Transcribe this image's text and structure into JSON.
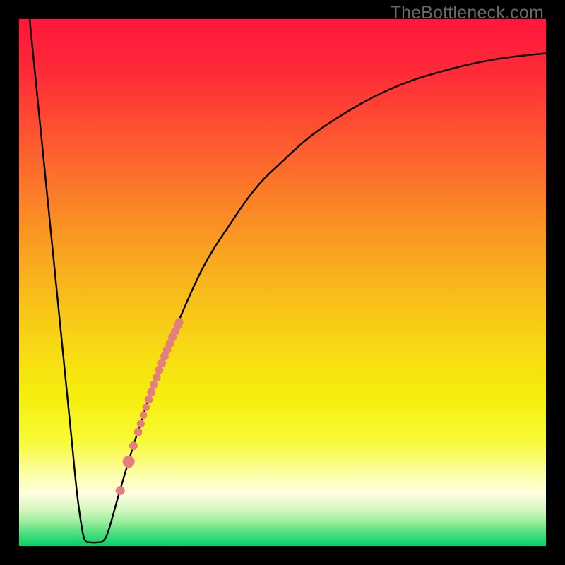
{
  "watermark": "TheBottleneck.com",
  "colors": {
    "frame": "#000000",
    "curve": "#000000",
    "dot": "#e57f7d",
    "gradient_stops": [
      {
        "offset": 0.0,
        "color": "#ff163c"
      },
      {
        "offset": 0.1,
        "color": "#ff2a38"
      },
      {
        "offset": 0.22,
        "color": "#fd5530"
      },
      {
        "offset": 0.35,
        "color": "#fb8327"
      },
      {
        "offset": 0.5,
        "color": "#f8b61c"
      },
      {
        "offset": 0.62,
        "color": "#f7d814"
      },
      {
        "offset": 0.72,
        "color": "#f6ef0d"
      },
      {
        "offset": 0.8,
        "color": "#f8fa35"
      },
      {
        "offset": 0.86,
        "color": "#fcfea0"
      },
      {
        "offset": 0.9,
        "color": "#fefee0"
      },
      {
        "offset": 0.93,
        "color": "#d7f7c1"
      },
      {
        "offset": 0.955,
        "color": "#99ed9c"
      },
      {
        "offset": 0.975,
        "color": "#4fdf81"
      },
      {
        "offset": 1.0,
        "color": "#06d166"
      }
    ]
  },
  "chart_data": {
    "type": "line",
    "title": "",
    "xlabel": "",
    "ylabel": "",
    "xlim": [
      0,
      100
    ],
    "ylim": [
      0,
      100
    ],
    "grid": false,
    "curve": [
      {
        "x": 2.0,
        "y": 100.0
      },
      {
        "x": 4.0,
        "y": 80.0
      },
      {
        "x": 6.0,
        "y": 60.0
      },
      {
        "x": 8.0,
        "y": 40.0
      },
      {
        "x": 10.0,
        "y": 20.0
      },
      {
        "x": 11.0,
        "y": 10.0
      },
      {
        "x": 12.0,
        "y": 3.0
      },
      {
        "x": 12.6,
        "y": 1.0
      },
      {
        "x": 13.5,
        "y": 0.7
      },
      {
        "x": 15.0,
        "y": 0.7
      },
      {
        "x": 16.0,
        "y": 1.0
      },
      {
        "x": 17.0,
        "y": 3.0
      },
      {
        "x": 19.0,
        "y": 10.0
      },
      {
        "x": 22.0,
        "y": 20.0
      },
      {
        "x": 26.0,
        "y": 32.0
      },
      {
        "x": 30.0,
        "y": 42.0
      },
      {
        "x": 35.0,
        "y": 53.0
      },
      {
        "x": 40.0,
        "y": 61.0
      },
      {
        "x": 45.0,
        "y": 68.0
      },
      {
        "x": 50.0,
        "y": 73.0
      },
      {
        "x": 55.0,
        "y": 77.5
      },
      {
        "x": 60.0,
        "y": 81.0
      },
      {
        "x": 65.0,
        "y": 84.0
      },
      {
        "x": 70.0,
        "y": 86.5
      },
      {
        "x": 75.0,
        "y": 88.5
      },
      {
        "x": 80.0,
        "y": 90.0
      },
      {
        "x": 85.0,
        "y": 91.3
      },
      {
        "x": 90.0,
        "y": 92.3
      },
      {
        "x": 95.0,
        "y": 93.0
      },
      {
        "x": 100.0,
        "y": 93.5
      }
    ],
    "dots": [
      {
        "x": 19.2,
        "y": 10.5,
        "r": 6.5
      },
      {
        "x": 20.8,
        "y": 16.0,
        "r": 8.5
      },
      {
        "x": 21.7,
        "y": 19.0,
        "r": 6.0
      },
      {
        "x": 22.6,
        "y": 21.6,
        "r": 5.8
      },
      {
        "x": 23.1,
        "y": 23.2,
        "r": 5.6
      },
      {
        "x": 23.6,
        "y": 24.8,
        "r": 5.4
      },
      {
        "x": 24.1,
        "y": 26.3,
        "r": 5.3
      },
      {
        "x": 24.6,
        "y": 27.8,
        "r": 5.9
      },
      {
        "x": 25.1,
        "y": 29.2,
        "r": 5.9
      },
      {
        "x": 25.6,
        "y": 30.6,
        "r": 5.9
      },
      {
        "x": 26.1,
        "y": 32.0,
        "r": 5.9
      },
      {
        "x": 26.6,
        "y": 33.4,
        "r": 5.9
      },
      {
        "x": 27.1,
        "y": 34.7,
        "r": 5.9
      },
      {
        "x": 27.6,
        "y": 36.0,
        "r": 5.9
      },
      {
        "x": 28.1,
        "y": 37.2,
        "r": 5.9
      },
      {
        "x": 28.6,
        "y": 38.4,
        "r": 5.9
      },
      {
        "x": 29.1,
        "y": 39.6,
        "r": 5.9
      },
      {
        "x": 29.6,
        "y": 40.7,
        "r": 5.9
      },
      {
        "x": 30.1,
        "y": 41.8,
        "r": 5.9
      },
      {
        "x": 30.4,
        "y": 42.5,
        "r": 5.9
      }
    ]
  }
}
